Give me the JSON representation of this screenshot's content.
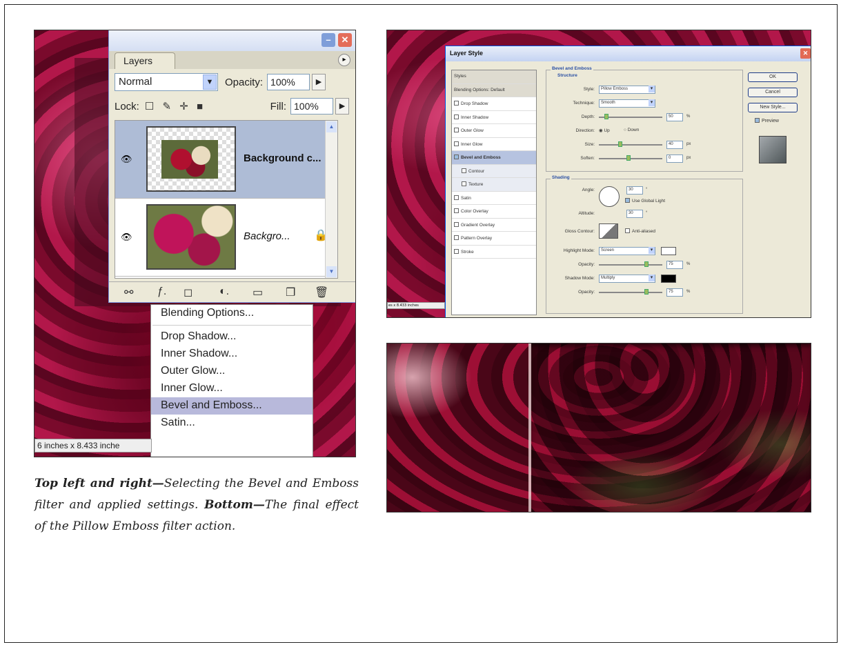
{
  "layers_panel": {
    "tab_label": "Layers",
    "blend_mode": "Normal",
    "opacity_label": "Opacity:",
    "opacity_value": "100%",
    "lock_label": "Lock:",
    "fill_label": "Fill:",
    "fill_value": "100%",
    "layers": [
      {
        "name": "Background c...",
        "selected": true
      },
      {
        "name": "Backgro...",
        "selected": false
      }
    ]
  },
  "context_menu": {
    "items": [
      "Blending Options...",
      "Drop Shadow...",
      "Inner Shadow...",
      "Outer Glow...",
      "Inner Glow...",
      "Bevel and Emboss...",
      "Satin..."
    ],
    "highlighted": "Bevel and Emboss..."
  },
  "left_status": "6 inches x 8.433 inche",
  "caption": {
    "lead1": "Top left and right—",
    "text1": "Selecting the Bevel and Emboss filter and applied settings. ",
    "lead2": "Bottom—",
    "text2": "The final effect of the Pillow Emboss filter action."
  },
  "layer_style_dialog": {
    "title": "Layer Style",
    "styles_list": {
      "header": "Styles",
      "blending_options": "Blending Options: Default",
      "items": [
        "Drop Shadow",
        "Inner Shadow",
        "Outer Glow",
        "Inner Glow",
        "Bevel and Emboss",
        "Contour",
        "Texture",
        "Satin",
        "Color Overlay",
        "Gradient Overlay",
        "Pattern Overlay",
        "Stroke"
      ],
      "selected": "Bevel and Emboss"
    },
    "bevel_group": {
      "title": "Bevel and Emboss",
      "structure_title": "Structure",
      "style_label": "Style:",
      "style_value": "Pillow Emboss",
      "technique_label": "Technique:",
      "technique_value": "Smooth",
      "depth_label": "Depth:",
      "depth_value": "50",
      "direction_label": "Direction:",
      "direction_up": "Up",
      "direction_down": "Down",
      "size_label": "Size:",
      "size_value": "40",
      "soften_label": "Soften:",
      "soften_value": "0"
    },
    "shading_group": {
      "title": "Shading",
      "angle_label": "Angle:",
      "angle_value": "30",
      "use_global_light": "Use Global Light",
      "altitude_label": "Altitude:",
      "altitude_value": "30",
      "gloss_contour_label": "Gloss Contour:",
      "anti_aliased": "Anti-aliased",
      "highlight_mode_label": "Highlight Mode:",
      "highlight_mode_value": "Screen",
      "highlight_opacity_label": "Opacity:",
      "highlight_opacity_value": "75",
      "shadow_mode_label": "Shadow Mode:",
      "shadow_mode_value": "Multiply",
      "shadow_opacity_label": "Opacity:",
      "shadow_opacity_value": "75"
    },
    "buttons": {
      "ok": "OK",
      "cancel": "Cancel",
      "new_style": "New Style...",
      "preview": "Preview"
    },
    "status": "es x 8.433 inches"
  },
  "colors": {
    "rose_dark": "#7c0c2a",
    "xp_panel": "#ece9d8",
    "xp_blue": "#0054e3",
    "menu_highlight": "#b8b9db"
  }
}
